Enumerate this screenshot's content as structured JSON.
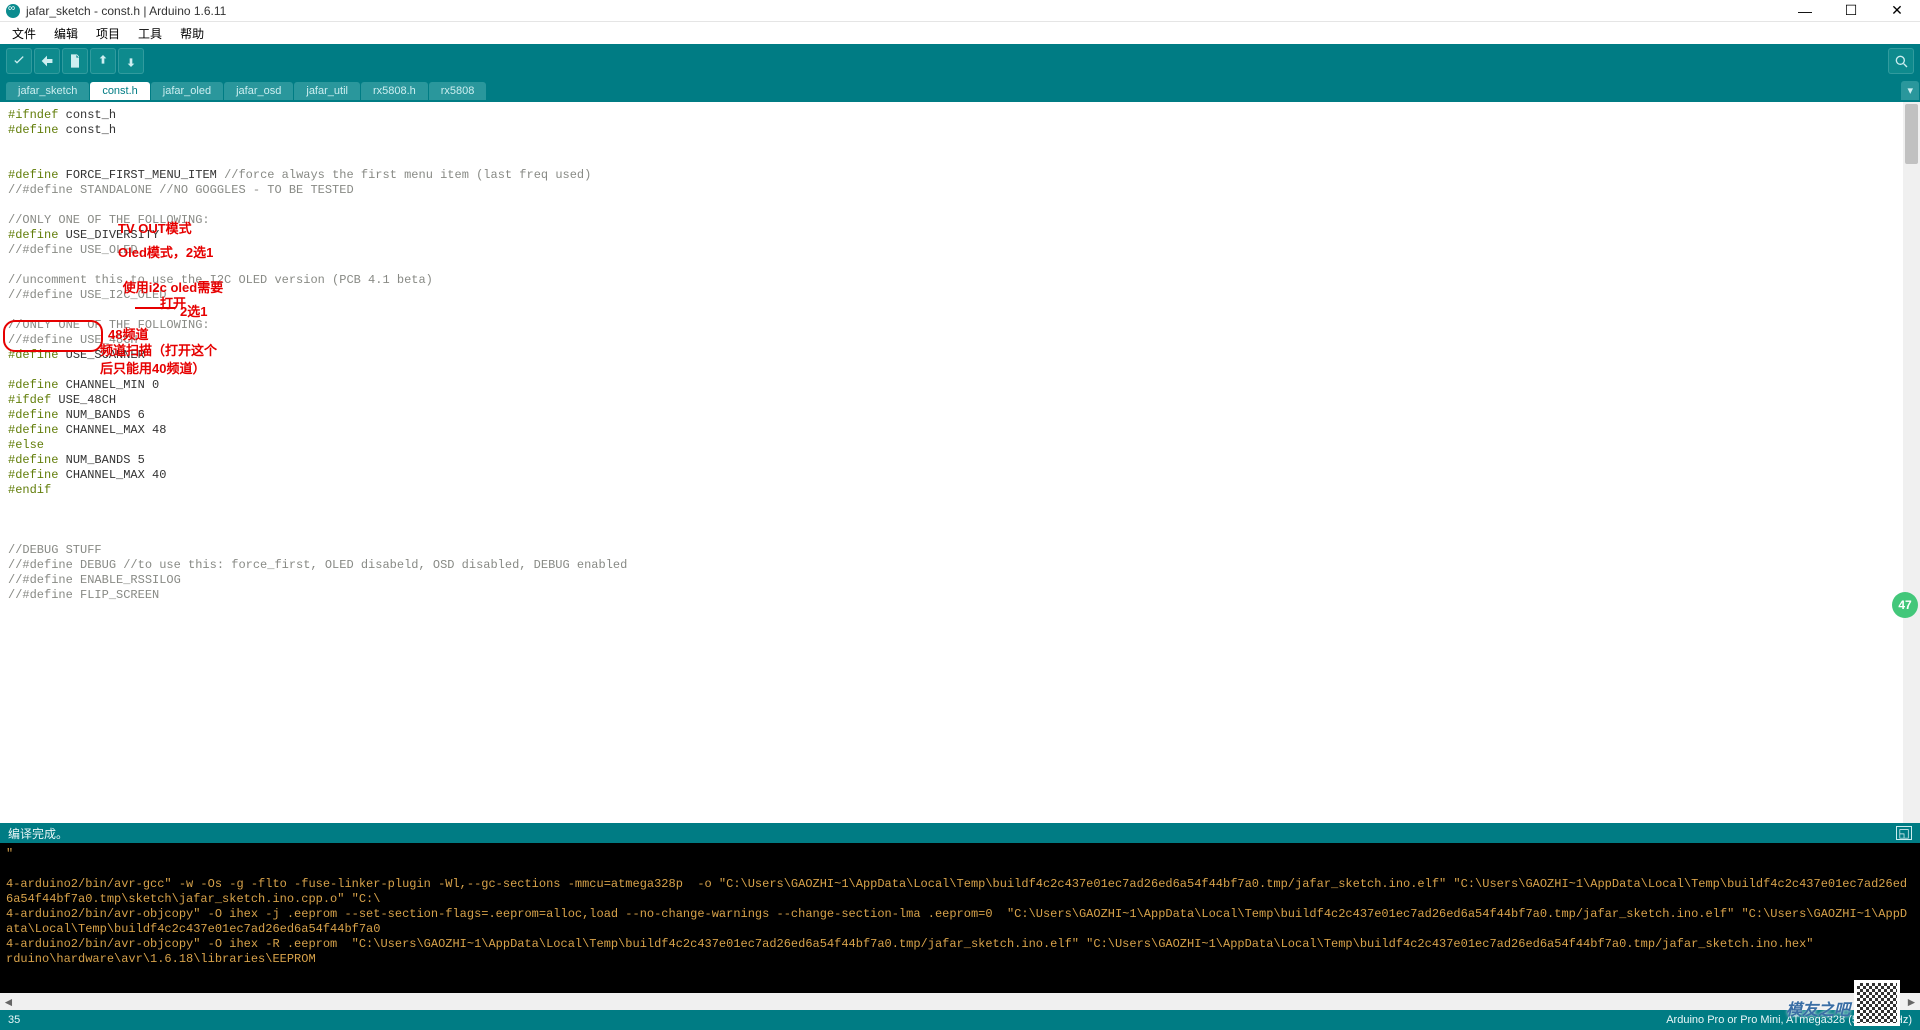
{
  "window": {
    "title": "jafar_sketch - const.h | Arduino 1.6.11"
  },
  "menu": {
    "file": "文件",
    "edit": "编辑",
    "project": "项目",
    "tools": "工具",
    "help": "帮助"
  },
  "tabs": [
    "jafar_sketch",
    "const.h",
    "jafar_oled",
    "jafar_osd",
    "jafar_util",
    "rx5808.h",
    "rx5808"
  ],
  "active_tab": 1,
  "annotations": {
    "tv_out": "TV OUT模式",
    "oled_mode": "Oled模式，2选1",
    "i2c_oled": "使用i2c oled需要打开",
    "choose_one": "2选1",
    "ch48": "48频道",
    "scanner": "频道扫描（打开这个后只能用40频道）"
  },
  "status": {
    "compile": "编译完成。",
    "expand_hint": "□"
  },
  "footer": {
    "line": "35",
    "board": "Arduino Pro or Pro Mini, ATmega328 (5V, 16 MHz)"
  },
  "badge": "47",
  "brand": "模友之吧",
  "code": {
    "l1a": "#ifndef",
    "l1b": " const_h",
    "l2a": "#define",
    "l2b": " const_h",
    "l4a": "#define",
    "l4b": " FORCE_FIRST_MENU_ITEM ",
    "l4c": "//force always the first menu item (last freq used)",
    "l5": "//#define STANDALONE //NO GOGGLES - TO BE TESTED",
    "l7": "//ONLY ONE OF THE FOLLOWING:",
    "l8a": "#define",
    "l8b": " USE_DIVERSITY",
    "l9": "//#define USE_OLED",
    "l11": "//uncomment this to use the I2C OLED version (PCB 4.1 beta)",
    "l12": "//#define USE_I2C_OLED",
    "l14": "//ONLY ONE OF THE FOLLOWING:",
    "l15": "//#define USE_48CH",
    "l16a": "#define",
    "l16b": " USE_SCANNER",
    "l18a": "#define",
    "l18b": " CHANNEL_MIN 0",
    "l19a": "#ifdef",
    "l19b": " USE_48CH",
    "l20a": "#define",
    "l20b": " NUM_BANDS 6",
    "l21a": "#define",
    "l21b": " CHANNEL_MAX 48",
    "l22": "#else",
    "l23a": "#define",
    "l23b": " NUM_BANDS 5",
    "l24a": "#define",
    "l24b": " CHANNEL_MAX 40",
    "l25": "#endif",
    "l29": "//DEBUG STUFF",
    "l30": "//#define DEBUG //to use this: force_first, OLED disabeld, OSD disabled, DEBUG enabled",
    "l31": "//#define ENABLE_RSSILOG",
    "l32": "//#define FLIP_SCREEN"
  },
  "console": {
    "l0": "\"                                                                                                                                                                                                                                           ",
    "l1": "4-arduino2/bin/avr-gcc\" -w -Os -g -flto -fuse-linker-plugin -Wl,--gc-sections -mmcu=atmega328p  -o \"C:\\Users\\GAOZHI~1\\AppData\\Local\\Temp\\buildf4c2c437e01ec7ad26ed6a54f44bf7a0.tmp/jafar_sketch.ino.elf\" \"C:\\Users\\GAOZHI~1\\AppData\\Local\\Temp\\buildf4c2c437e01ec7ad26ed6a54f44bf7a0.tmp\\sketch\\jafar_sketch.ino.cpp.o\" \"C:\\",
    "l2": "4-arduino2/bin/avr-objcopy\" -O ihex -j .eeprom --set-section-flags=.eeprom=alloc,load --no-change-warnings --change-section-lma .eeprom=0  \"C:\\Users\\GAOZHI~1\\AppData\\Local\\Temp\\buildf4c2c437e01ec7ad26ed6a54f44bf7a0.tmp/jafar_sketch.ino.elf\" \"C:\\Users\\GAOZHI~1\\AppData\\Local\\Temp\\buildf4c2c437e01ec7ad26ed6a54f44bf7a0",
    "l3": "4-arduino2/bin/avr-objcopy\" -O ihex -R .eeprom  \"C:\\Users\\GAOZHI~1\\AppData\\Local\\Temp\\buildf4c2c437e01ec7ad26ed6a54f44bf7a0.tmp/jafar_sketch.ino.elf\" \"C:\\Users\\GAOZHI~1\\AppData\\Local\\Temp\\buildf4c2c437e01ec7ad26ed6a54f44bf7a0.tmp/jafar_sketch.ino.hex\"",
    "l4": "rduino\\hardware\\avr\\1.6.18\\libraries\\EEPROM"
  }
}
